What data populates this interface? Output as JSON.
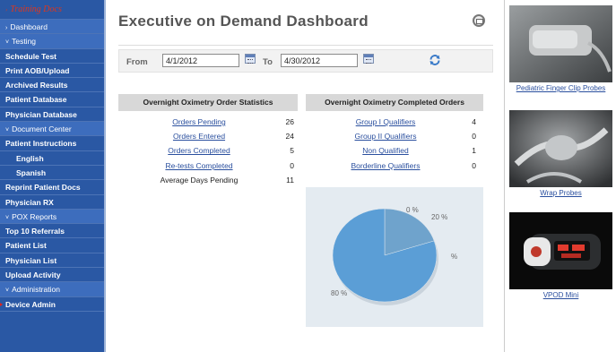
{
  "sidebar": {
    "brand": "Training Docs",
    "items": [
      {
        "label": "Dashboard",
        "type": "section",
        "caret": "›"
      },
      {
        "label": "Testing",
        "type": "section",
        "caret": "˅"
      },
      {
        "label": "Schedule Test",
        "type": "item"
      },
      {
        "label": "Print AOB/Upload",
        "type": "item"
      },
      {
        "label": "Archived Results",
        "type": "item"
      },
      {
        "label": "Patient Database",
        "type": "item"
      },
      {
        "label": "Physician Database",
        "type": "item"
      },
      {
        "label": "Document Center",
        "type": "section",
        "caret": "˅"
      },
      {
        "label": "Patient Instructions",
        "type": "item"
      },
      {
        "label": "English",
        "type": "sub"
      },
      {
        "label": "Spanish",
        "type": "sub"
      },
      {
        "label": "Reprint Patient Docs",
        "type": "item"
      },
      {
        "label": "Physician RX",
        "type": "item"
      },
      {
        "label": "POX Reports",
        "type": "section",
        "caret": "˅"
      },
      {
        "label": "Top 10 Referrals",
        "type": "item"
      },
      {
        "label": "Patient List",
        "type": "item"
      },
      {
        "label": "Physician List",
        "type": "item"
      },
      {
        "label": "Upload Activity",
        "type": "item"
      },
      {
        "label": "Administration",
        "type": "section",
        "caret": "˅"
      },
      {
        "label": "Device Admin",
        "type": "item"
      }
    ]
  },
  "header": {
    "title": "Executive on Demand Dashboard",
    "print_icon": "print-icon"
  },
  "date_filter": {
    "from_label": "From",
    "from_value": "4/1/2012",
    "to_label": "To",
    "to_value": "4/30/2012",
    "calendar_icon": "calendar-icon",
    "refresh_icon": "refresh-icon"
  },
  "order_stats": {
    "heading": "Overnight Oximetry Order Statistics",
    "rows": [
      {
        "label": "Orders Pending",
        "value": "26",
        "link": true
      },
      {
        "label": "Orders Entered",
        "value": "24",
        "link": true
      },
      {
        "label": "Orders Completed",
        "value": "5",
        "link": true
      },
      {
        "label": "Re-tests Completed",
        "value": "0",
        "link": true
      },
      {
        "label": "Average Days Pending",
        "value": "11",
        "link": false
      }
    ]
  },
  "completed_orders": {
    "heading": "Overnight Oximetry Completed Orders",
    "rows": [
      {
        "label": "Group I Qualifiers",
        "value": "4"
      },
      {
        "label": "Group II Qualifiers",
        "value": "0"
      },
      {
        "label": "Non Qualified",
        "value": "1"
      },
      {
        "label": "Borderline Qualifiers",
        "value": "0"
      }
    ]
  },
  "chart_data": {
    "type": "pie",
    "slices": [
      {
        "label": "0 %",
        "value": 0
      },
      {
        "label": "20 %",
        "value": 20
      },
      {
        "label": "%",
        "value": 0
      },
      {
        "label": "80 %",
        "value": 80
      }
    ],
    "colors": [
      "#4f8fc7",
      "#6fa3cc",
      "#8cc3e6",
      "#5b9ed6"
    ]
  },
  "products": [
    {
      "name": "Pediatric Finger Clip Probes"
    },
    {
      "name": "Wrap Probes"
    },
    {
      "name": "VPOD Mini"
    }
  ]
}
